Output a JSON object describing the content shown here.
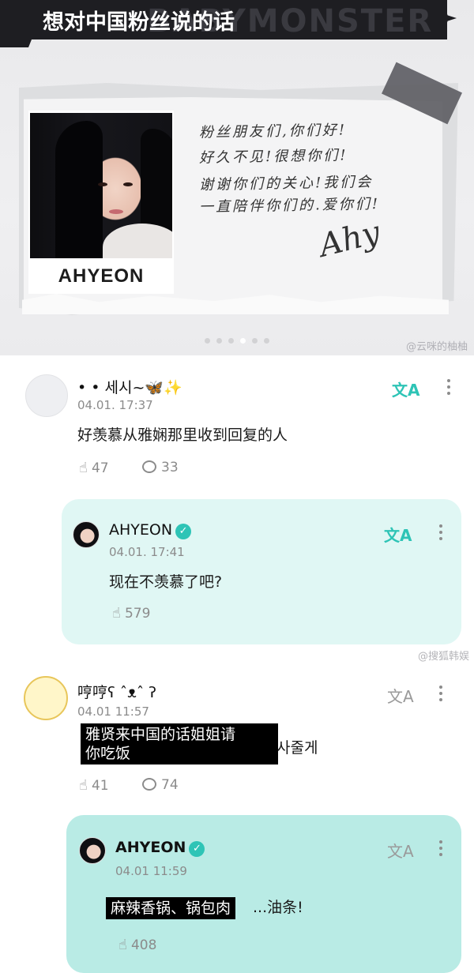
{
  "banner": {
    "title": "想对中国粉丝说的话",
    "bg_word": "BABYMONSTER",
    "photo_name": "AHYEON",
    "note_lines": [
      "粉丝朋友们,你们好!",
      "好久不见!很想你们!",
      "谢谢你们的关心!我们会",
      "一直陪伴你们的.爱你们!"
    ],
    "signature": "Ahy",
    "watermark": "@云咪的柚柚"
  },
  "comments": [
    {
      "name": "• • 세시~🦋✨",
      "time": "04.01. 17:37",
      "text": "好羡慕从雅娴那里收到回复的人",
      "likes": "47",
      "replies": "33",
      "reply": {
        "name": "AHYEON",
        "time": "04.01. 17:41",
        "text": "现在不羡慕了吧?",
        "likes": "579"
      }
    },
    {
      "name": "哼哼ʕ ˆᴥˆ ʔ",
      "time": "04.01 11:57",
      "text_suffix": "사줄게",
      "caption": [
        "雅贤来中国的话姐姐请",
        "你吃饭"
      ],
      "likes": "41",
      "replies": "74",
      "reply": {
        "name": "AHYEON",
        "time": "04.01 11:59",
        "caption": "麻辣香锅、锅包肉",
        "text_suffix": "...油条!",
        "likes": "408"
      }
    }
  ],
  "watermark2": "@搜狐韩娱",
  "translate_icon": "文A",
  "colors": {
    "accent": "#2ec4b6",
    "reply_bg": "#e0f7f4"
  }
}
